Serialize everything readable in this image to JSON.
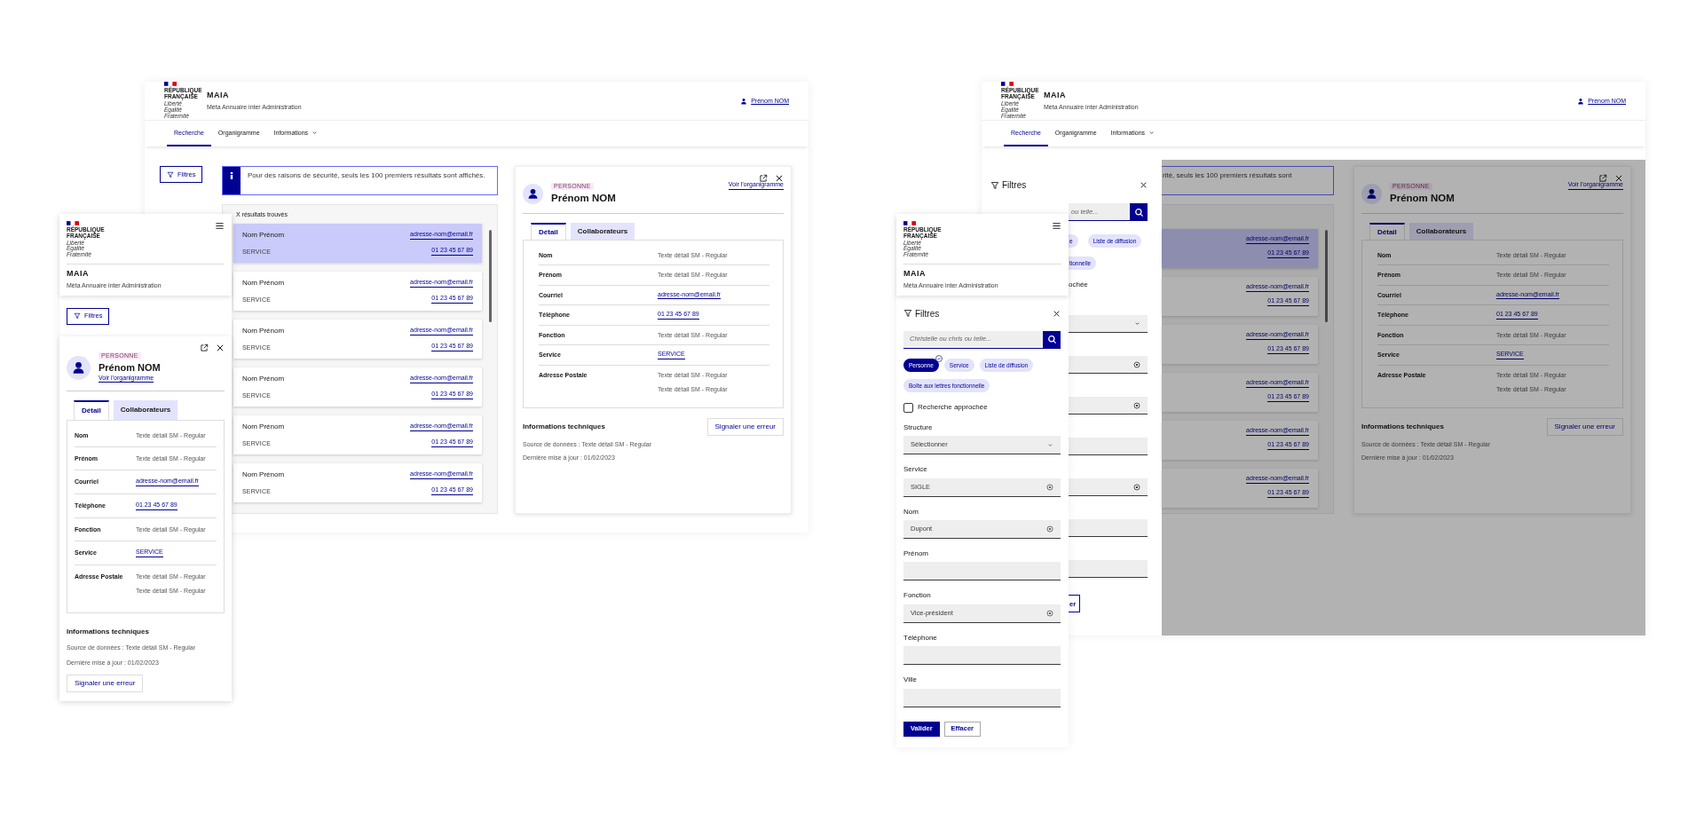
{
  "desktop_search": {
    "header": {
      "republic": "RÉPUBLIQUE FRANÇAISE",
      "motto": "Liberté Égalité Fraternité",
      "app_name": "MAIA",
      "app_subtitle": "Méta Annuaire inter Administration",
      "user": "Prénom NOM"
    },
    "nav": [
      {
        "label": "Recherche",
        "selected": true,
        "dropdown": false
      },
      {
        "label": "Organigramme",
        "selected": false,
        "dropdown": false
      },
      {
        "label": "Informations",
        "selected": false,
        "dropdown": true
      }
    ],
    "filters_button": "Filtres",
    "banner": {
      "text": "Pour des raisons de sécurité, seuls les 100 premiers résultats sont affichés."
    },
    "results": {
      "count": "X résultats trouvés",
      "items": [
        {
          "name": "Nom Prénom",
          "service": "SERVICE",
          "email": "adresse-nom@email.fr",
          "phone": "01 23 45 67 89",
          "selected": true
        },
        {
          "name": "Nom Prénom",
          "service": "SERVICE",
          "email": "adresse-nom@email.fr",
          "phone": "01 23 45 67 89",
          "selected": false
        },
        {
          "name": "Nom Prénom",
          "service": "SERVICE",
          "email": "adresse-nom@email.fr",
          "phone": "01 23 45 67 89",
          "selected": false
        },
        {
          "name": "Nom Prénom",
          "service": "SERVICE",
          "email": "adresse-nom@email.fr",
          "phone": "01 23 45 67 89",
          "selected": false
        },
        {
          "name": "Nom Prénom",
          "service": "SERVICE",
          "email": "adresse-nom@email.fr",
          "phone": "01 23 45 67 89",
          "selected": false
        },
        {
          "name": "Nom Prénom",
          "service": "SERVICE",
          "email": "adresse-nom@email.fr",
          "phone": "01 23 45 67 89",
          "selected": false
        }
      ]
    },
    "detail": {
      "badge": "PERSONNE",
      "name": "Prénom NOM",
      "org_link": "Voir l’organigramme",
      "tabs": [
        {
          "label": "Détail",
          "selected": true
        },
        {
          "label": "Collaborateurs",
          "selected": false
        }
      ],
      "rows": [
        {
          "label": "Nom",
          "values": [
            {
              "text": "Texte détail SM - Regular",
              "link": false
            }
          ]
        },
        {
          "label": "Prénom",
          "values": [
            {
              "text": "Texte détail SM - Regular",
              "link": false
            }
          ]
        },
        {
          "label": "Courriel",
          "values": [
            {
              "text": "adresse-nom@email.fr",
              "link": true
            }
          ]
        },
        {
          "label": "Téléphone",
          "values": [
            {
              "text": "01 23 45 67 89",
              "link": true
            }
          ]
        },
        {
          "label": "Fonction",
          "values": [
            {
              "text": "Texte détail SM - Regular",
              "link": false
            }
          ]
        },
        {
          "label": "Service",
          "values": [
            {
              "text": "SERVICE",
              "link": true
            }
          ]
        },
        {
          "label": "Adresse Postale",
          "values": [
            {
              "text": "Texte détail SM - Regular",
              "link": false
            },
            {
              "text": "Texte détail SM - Regular",
              "link": false
            }
          ]
        }
      ],
      "tech_title": "Informations techniques",
      "report_button": "Signaler une erreur",
      "source": "Source de données : Texte détail SM - Regular",
      "updated": "Dernière mise à jour : 01/02/2023"
    }
  },
  "mobile_detail": {
    "header": {
      "republic": "RÉPUBLIQUE FRANÇAISE",
      "motto": "Liberté Égalité Fraternité",
      "app_name": "MAIA",
      "app_subtitle": "Méta Annuaire inter Administration"
    },
    "filters_button": "Filtres",
    "detail": {
      "badge": "PERSONNE",
      "name": "Prénom NOM",
      "org_link": "Voir l’organigramme",
      "tabs": [
        {
          "label": "Détail",
          "selected": true
        },
        {
          "label": "Collaborateurs",
          "selected": false
        }
      ],
      "rows": [
        {
          "label": "Nom",
          "values": [
            {
              "text": "Texte détail SM - Regular",
              "link": false
            }
          ]
        },
        {
          "label": "Prénom",
          "values": [
            {
              "text": "Texte détail SM - Regular",
              "link": false
            }
          ]
        },
        {
          "label": "Courriel",
          "values": [
            {
              "text": "adresse-nom@email.fr",
              "link": true
            }
          ]
        },
        {
          "label": "Téléphone",
          "values": [
            {
              "text": "01 23 45 67 89",
              "link": true
            }
          ]
        },
        {
          "label": "Fonction",
          "values": [
            {
              "text": "Texte détail SM - Regular",
              "link": false
            }
          ]
        },
        {
          "label": "Service",
          "values": [
            {
              "text": "SERVICE",
              "link": true
            }
          ]
        },
        {
          "label": "Adresse Postale",
          "values": [
            {
              "text": "Texte détail SM - Regular",
              "link": false
            },
            {
              "text": "Texte détail SM - Regular",
              "link": false
            }
          ]
        }
      ],
      "tech_title": "Informations techniques",
      "report_button": "Signaler une erreur",
      "source": "Source de données : Texte détail SM - Regular",
      "updated": "Dernière mise à jour : 01/02/2023"
    }
  },
  "desktop_filters": {
    "header": {
      "republic": "RÉPUBLIQUE FRANÇAISE",
      "motto": "Liberté Égalité Fraternité",
      "app_name": "MAIA",
      "app_subtitle": "Méta Annuaire inter Administration",
      "user": "Prénom NOM"
    },
    "nav": [
      {
        "label": "Recherche",
        "selected": true,
        "dropdown": false
      },
      {
        "label": "Organigramme",
        "selected": false,
        "dropdown": false
      },
      {
        "label": "Informations",
        "selected": false,
        "dropdown": true
      }
    ],
    "drawer": {
      "title": "Filtres",
      "search_placeholder": "ou telle...",
      "chips": [
        {
          "label": "e",
          "selected": false
        },
        {
          "label": "Liste de diffusion",
          "selected": false
        },
        {
          "label": "tionnelle",
          "selected": false
        }
      ],
      "checkbox_label": "ochée",
      "fields": [
        {
          "kind": "select"
        },
        {
          "kind": "clearable"
        },
        {
          "kind": "clearable"
        },
        {
          "kind": "text"
        },
        {
          "kind": "clearable"
        },
        {
          "kind": "text"
        },
        {
          "kind": "text"
        }
      ],
      "button": "er"
    },
    "banner": {
      "text": "rité, seuls les 100 premiers résultats sont"
    },
    "results": {
      "items": [
        {
          "email": "adresse-nom@email.fr",
          "phone": "01 23 45 67 89",
          "selected": true
        },
        {
          "email": "adresse-nom@email.fr",
          "phone": "01 23 45 67 89",
          "selected": false
        },
        {
          "email": "adresse-nom@email.fr",
          "phone": "01 23 45 67 89",
          "selected": false
        },
        {
          "email": "adresse-nom@email.fr",
          "phone": "01 23 45 67 89",
          "selected": false
        },
        {
          "email": "adresse-nom@email.fr",
          "phone": "01 23 45 67 89",
          "selected": false
        },
        {
          "email": "adresse-nom@email.fr",
          "phone": "01 23 45 67 89",
          "selected": false
        }
      ]
    },
    "detail": {
      "badge": "PERSONNE",
      "name": "Prénom NOM",
      "org_link": "Voir l’organigramme",
      "tabs": [
        {
          "label": "Détail",
          "selected": true
        },
        {
          "label": "Collaborateurs",
          "selected": false
        }
      ],
      "rows": [
        {
          "label": "Nom",
          "values": [
            {
              "text": "Texte détail SM - Regular",
              "link": false
            }
          ]
        },
        {
          "label": "Prénom",
          "values": [
            {
              "text": "Texte détail SM - Regular",
              "link": false
            }
          ]
        },
        {
          "label": "Courriel",
          "values": [
            {
              "text": "adresse-nom@email.fr",
              "link": true
            }
          ]
        },
        {
          "label": "Téléphone",
          "values": [
            {
              "text": "01 23 45 67 89",
              "link": true
            }
          ]
        },
        {
          "label": "Fonction",
          "values": [
            {
              "text": "Texte détail SM - Regular",
              "link": false
            }
          ]
        },
        {
          "label": "Service",
          "values": [
            {
              "text": "SERVICE",
              "link": true
            }
          ]
        },
        {
          "label": "Adresse Postale",
          "values": [
            {
              "text": "Texte détail SM - Regular",
              "link": false
            },
            {
              "text": "Texte détail SM - Regular",
              "link": false
            }
          ]
        }
      ],
      "tech_title": "Informations techniques",
      "report_button": "Signaler une erreur",
      "source": "Source de données : Texte détail SM - Regular",
      "updated": "Dernière mise à jour : 01/02/2023"
    }
  },
  "mobile_filters": {
    "header": {
      "republic": "RÉPUBLIQUE FRANÇAISE",
      "motto": "Liberté Égalité Fraternité",
      "app_name": "MAIA",
      "app_subtitle": "Méta Annuaire inter Administration"
    },
    "title": "Filtres",
    "search_placeholder": "Christelle ou chris ou telle...",
    "chips": [
      {
        "label": "Personne",
        "selected": true
      },
      {
        "label": "Service",
        "selected": false
      },
      {
        "label": "Liste de diffusion",
        "selected": false
      },
      {
        "label": "Boîte aux lettres fonctionnelle",
        "selected": false
      }
    ],
    "checkbox": {
      "label": "Recherche approchée",
      "checked": false
    },
    "fields": [
      {
        "label": "Structure",
        "kind": "select",
        "value": "Sélectionner"
      },
      {
        "label": "Service",
        "kind": "clearable",
        "value": "SIGLE"
      },
      {
        "label": "Nom",
        "kind": "clearable",
        "value": "Dupont"
      },
      {
        "label": "Prénom",
        "kind": "text"
      },
      {
        "label": "Fonction",
        "kind": "clearable",
        "value": "Vice-président"
      },
      {
        "label": "Téléphone",
        "kind": "text"
      },
      {
        "label": "Ville",
        "kind": "text"
      }
    ],
    "buttons": [
      {
        "label": "Valider",
        "kind": "primary"
      },
      {
        "label": "Effacer",
        "kind": "secondary"
      }
    ]
  }
}
